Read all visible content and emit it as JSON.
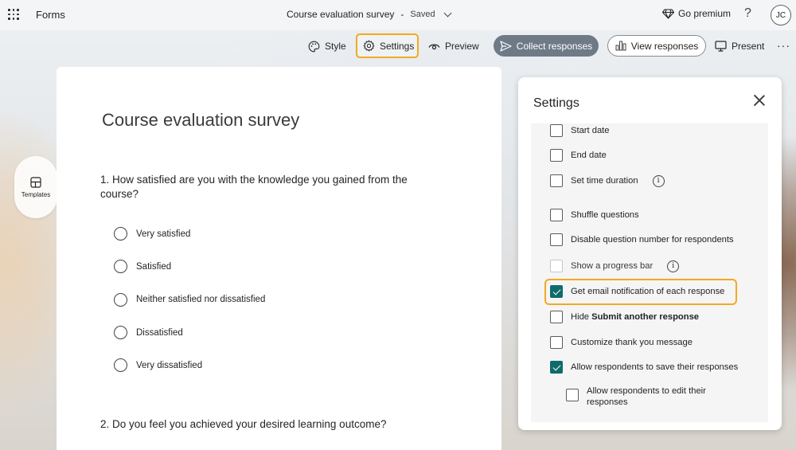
{
  "header": {
    "app_name": "Forms",
    "doc_title": "Course evaluation survey",
    "separator": "-",
    "save_status": "Saved",
    "premium_label": "Go premium",
    "help_glyph": "?",
    "avatar_initials": "JC"
  },
  "toolbar": {
    "style_label": "Style",
    "settings_label": "Settings",
    "preview_label": "Preview",
    "collect_label": "Collect responses",
    "view_label": "View responses",
    "present_label": "Present",
    "more_glyph": "···"
  },
  "sidebar": {
    "templates_label": "Templates"
  },
  "form": {
    "title": "Course evaluation survey",
    "question1": "1. How satisfied are you with the knowledge you gained from the course?",
    "question1_options": [
      "Very satisfied",
      "Satisfied",
      "Neither satisfied nor dissatisfied",
      "Dissatisfied",
      "Very dissatisfied"
    ],
    "question2": "2. Do you feel you achieved your desired learning outcome?"
  },
  "settings_panel": {
    "title": "Settings",
    "options": [
      {
        "label": "Start date",
        "checked": false
      },
      {
        "label": "End date",
        "checked": false
      },
      {
        "label": "Set time duration",
        "checked": false,
        "info": true
      },
      {
        "label": "Shuffle questions",
        "checked": false
      },
      {
        "label": "Disable question number for respondents",
        "checked": false
      },
      {
        "label": "Show a progress bar",
        "checked": false,
        "disabled": true,
        "info": true
      },
      {
        "label": "Get email notification of each response",
        "checked": true,
        "highlighted": true
      },
      {
        "label_prefix": "Hide ",
        "label_bold": "Submit another response",
        "checked": false
      },
      {
        "label": "Customize thank you message",
        "checked": false
      },
      {
        "label": "Allow respondents to save their responses",
        "checked": true
      },
      {
        "label": "Allow respondents to edit their responses",
        "checked": false,
        "indented": true
      }
    ]
  },
  "colors": {
    "accent": "#0f6b6b",
    "highlight": "#f3a922",
    "collect_button": "#6f7a87"
  },
  "icons": {
    "app_launcher": "waffle-icon",
    "premium": "diamond-icon",
    "style": "palette-icon",
    "settings": "gear-icon",
    "preview": "eye-icon",
    "collect": "send-icon",
    "view": "bar-chart-icon",
    "present": "monitor-icon",
    "templates": "layout-icon",
    "close": "close-icon",
    "info": "info-icon"
  }
}
